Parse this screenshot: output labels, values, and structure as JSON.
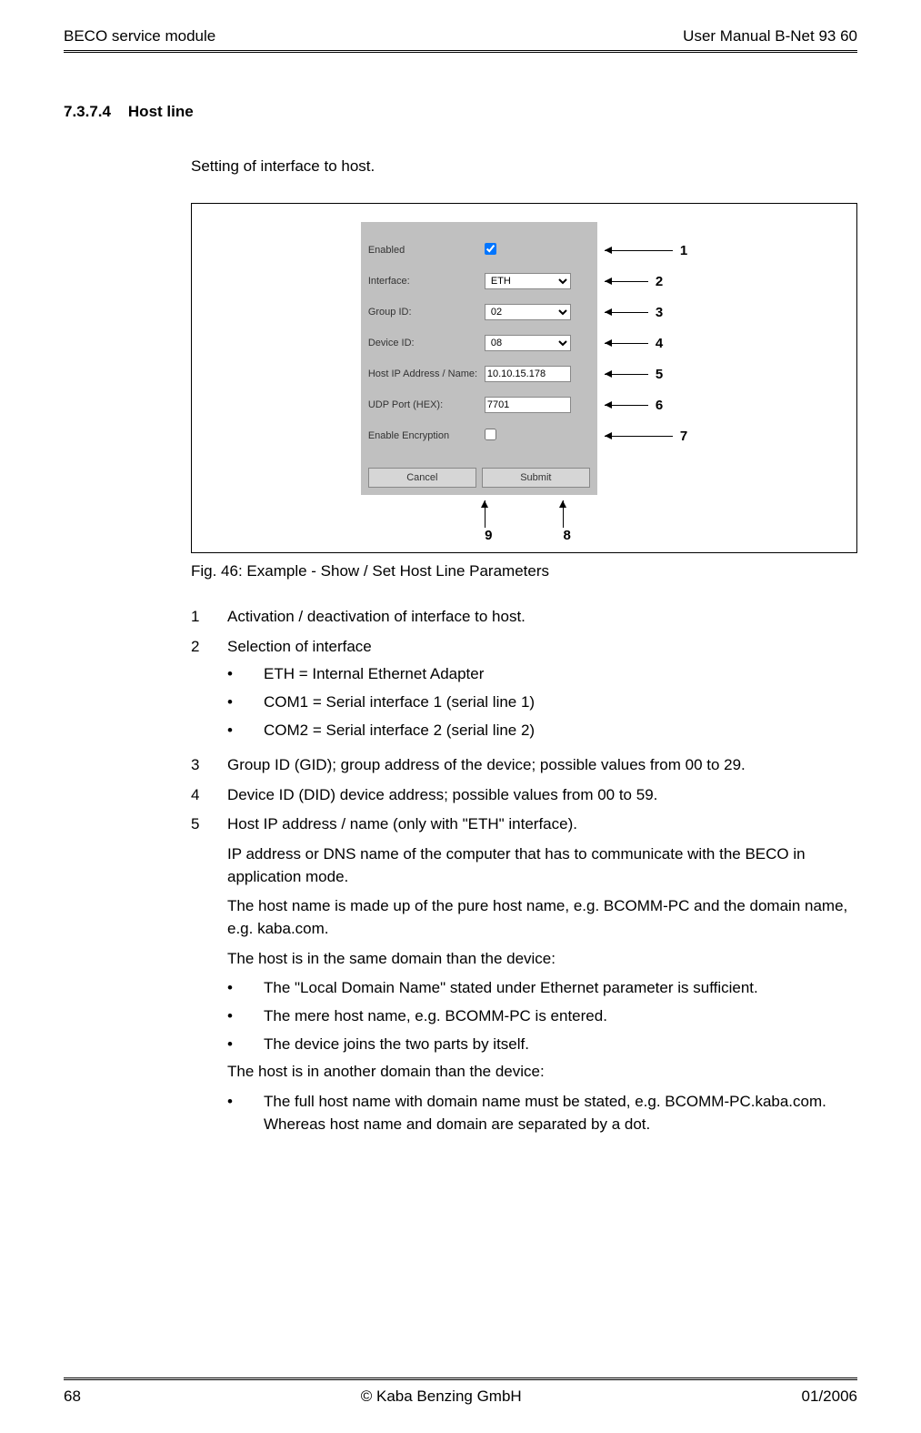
{
  "header": {
    "left": "BECO service module",
    "right": "User Manual B-Net 93 60"
  },
  "section": {
    "number": "7.3.7.4",
    "title": "Host line",
    "intro": "Setting of interface to host."
  },
  "dialog": {
    "enabled_label": "Enabled",
    "enabled_checked": true,
    "interface_label": "Interface:",
    "interface_value": "ETH",
    "group_label": "Group ID:",
    "group_value": "02",
    "device_label": "Device ID:",
    "device_value": "08",
    "hostip_label": "Host IP Address / Name:",
    "hostip_value": "10.10.15.178",
    "udp_label": "UDP Port (HEX):",
    "udp_value": "7701",
    "encrypt_label": "Enable Encryption",
    "encrypt_checked": false,
    "cancel": "Cancel",
    "submit": "Submit"
  },
  "annot": {
    "n1": "1",
    "n2": "2",
    "n3": "3",
    "n4": "4",
    "n5": "5",
    "n6": "6",
    "n7": "7",
    "n8": "8",
    "n9": "9"
  },
  "caption": "Fig. 46: Example - Show / Set Host Line Parameters",
  "items": {
    "i1": {
      "num": "1",
      "text": "Activation / deactivation of interface to host."
    },
    "i2": {
      "num": "2",
      "text": "Selection of interface",
      "bullets": {
        "b1": "ETH = Internal Ethernet Adapter",
        "b2": "COM1 = Serial interface 1 (serial line 1)",
        "b3": "COM2 = Serial interface 2 (serial line 2)"
      }
    },
    "i3": {
      "num": "3",
      "text": "Group ID (GID); group address of the device; possible values from 00 to 29."
    },
    "i4": {
      "num": "4",
      "text": "Device ID (DID) device address; possible values from 00 to 59."
    },
    "i5": {
      "num": "5",
      "text": "Host IP address / name (only with \"ETH\" interface).",
      "p1": "IP address or DNS name of the computer that has to communicate with the BECO in application mode.",
      "p2": "The host name is made up of the pure host name, e.g. BCOMM-PC and the domain name, e.g. kaba.com.",
      "p3": "The host is in the same domain than the device:",
      "bullets1": {
        "b1": "The \"Local Domain Name\" stated under Ethernet parameter is sufficient.",
        "b2": "The mere host name, e.g. BCOMM-PC is entered.",
        "b3": "The device joins the two parts by itself."
      },
      "p4": "The host is in another domain than the device:",
      "bullets2": {
        "b1": "The full host name with domain name must be stated, e.g. BCOMM-PC.kaba.com. Whereas host name and domain are separated by a dot."
      }
    }
  },
  "footer": {
    "page": "68",
    "center": "© Kaba Benzing GmbH",
    "right": "01/2006"
  }
}
